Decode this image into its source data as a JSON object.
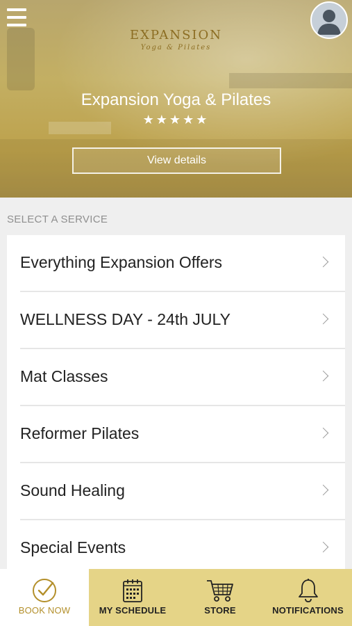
{
  "header": {
    "logo_main": "EXPANSION",
    "logo_sub": "Yoga & Pilates",
    "studio_name": "Expansion Yoga & Pilates",
    "rating": "★★★★★",
    "rating_value": 5,
    "view_details_label": "View details"
  },
  "section_title": "SELECT A SERVICE",
  "services": [
    {
      "label": "Everything Expansion Offers"
    },
    {
      "label": "WELLNESS DAY - 24th JULY"
    },
    {
      "label": "Mat Classes"
    },
    {
      "label": "Reformer Pilates"
    },
    {
      "label": "Sound Healing"
    },
    {
      "label": "Special Events"
    }
  ],
  "tabs": [
    {
      "label": "BOOK NOW",
      "icon": "check-circle-icon",
      "active": true
    },
    {
      "label": "MY SCHEDULE",
      "icon": "calendar-icon",
      "active": false
    },
    {
      "label": "STORE",
      "icon": "cart-icon",
      "active": false
    },
    {
      "label": "NOTIFICATIONS",
      "icon": "bell-icon",
      "active": false
    }
  ],
  "colors": {
    "accent_gold": "#b38f2a",
    "tab_bar_bg": "#e5d487",
    "hero_gold": "#bda24d"
  }
}
